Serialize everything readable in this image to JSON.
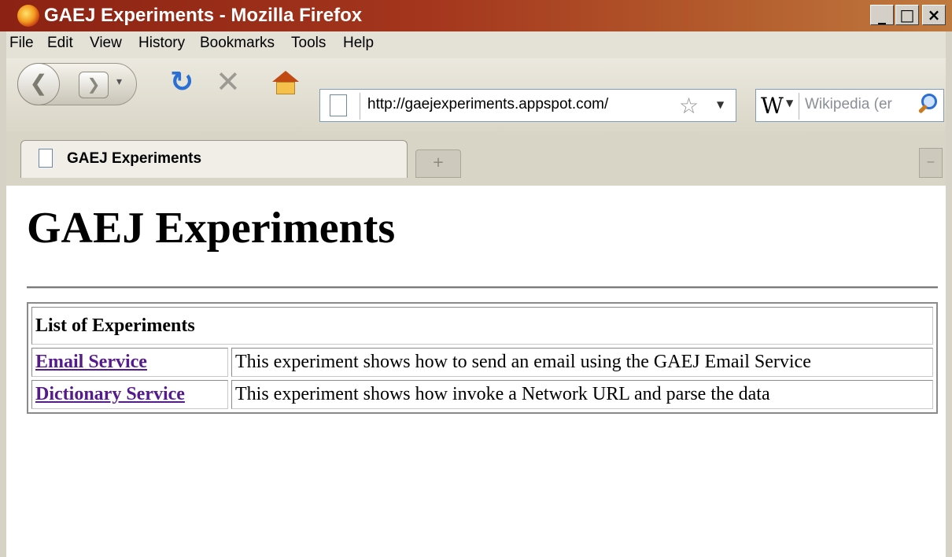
{
  "window": {
    "title": "GAEJ Experiments - Mozilla Firefox",
    "controls": {
      "minimize": "_",
      "maximize": "□",
      "close": "×"
    }
  },
  "menu": [
    "File",
    "Edit",
    "View",
    "History",
    "Bookmarks",
    "Tools",
    "Help"
  ],
  "toolbar": {
    "url": "http://gaejexperiments.appspot.com/",
    "search_engine": "W",
    "search_placeholder": "Wikipedia (er"
  },
  "tabs": [
    {
      "label": "GAEJ Experiments",
      "active": true
    }
  ],
  "page": {
    "heading": "GAEJ Experiments",
    "table": {
      "header": "List of Experiments",
      "rows": [
        {
          "link": "Email Service",
          "description": "This experiment shows how to send an email using the GAEJ Email Service"
        },
        {
          "link": "Dictionary Service",
          "description": "This experiment shows how invoke a Network URL and parse the data"
        }
      ]
    }
  },
  "colors": {
    "titlebar_start": "#8b2213",
    "titlebar_end": "#bf7a3f",
    "chrome": "#d9d5c6",
    "visited_link": "#551a8b",
    "reload_blue": "#2a6fd3"
  },
  "icons": [
    "firefox-logo",
    "back-icon",
    "forward-icon",
    "reload-icon",
    "stop-icon",
    "home-icon",
    "page-icon",
    "bookmark-star-icon",
    "wikipedia-icon",
    "search-icon"
  ]
}
